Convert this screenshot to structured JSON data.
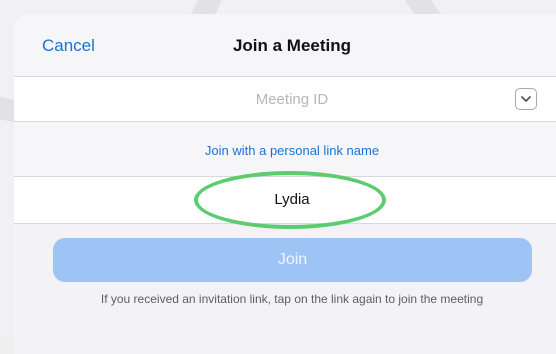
{
  "nav": {
    "cancel_label": "Cancel",
    "title": "Join a Meeting"
  },
  "meeting_id": {
    "placeholder": "Meeting ID",
    "value": "",
    "dropdown_icon": "chevron-down-icon"
  },
  "personal_link": {
    "label": "Join with a personal link name"
  },
  "name_field": {
    "value": "Lydia"
  },
  "join_button": {
    "label": "Join"
  },
  "hint": {
    "text": "If you received an invitation link, tap on the link again to join the meeting"
  },
  "colors": {
    "accent": "#1a73d4",
    "join_disabled": "#9dc4f5",
    "highlight": "#5bcc6f"
  }
}
